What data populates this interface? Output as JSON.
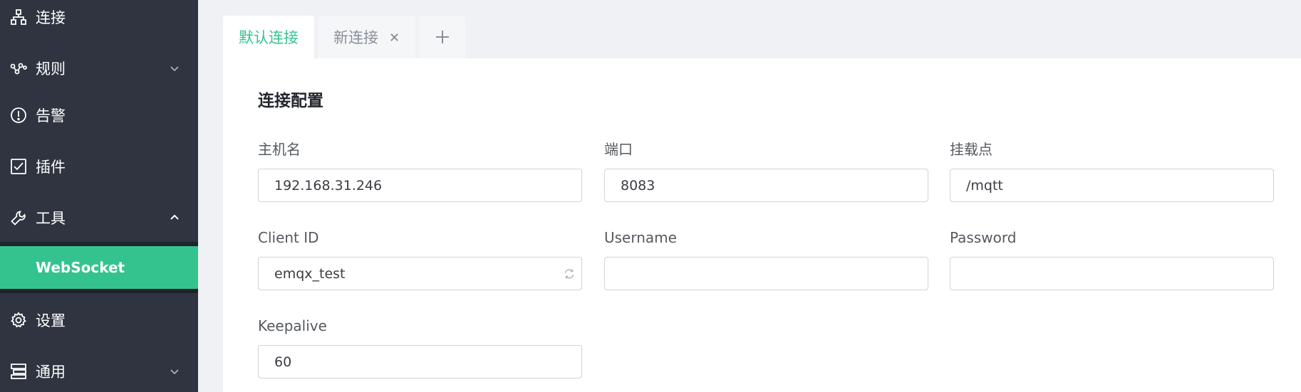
{
  "sidebar": {
    "items": [
      {
        "label": "连接",
        "icon": "network-icon"
      },
      {
        "label": "规则",
        "icon": "nodes-icon"
      },
      {
        "label": "告警",
        "icon": "alert-icon"
      },
      {
        "label": "插件",
        "icon": "checkbox-icon"
      },
      {
        "label": "工具",
        "icon": "wrench-icon"
      },
      {
        "label": "设置",
        "icon": "gear-icon"
      },
      {
        "label": "通用",
        "icon": "layers-icon"
      }
    ],
    "submenu": {
      "label": "WebSocket"
    }
  },
  "tabs": [
    {
      "label": "默认连接",
      "active": true
    },
    {
      "label": "新连接",
      "active": false
    }
  ],
  "panel": {
    "title": "连接配置",
    "fields": {
      "host": {
        "label": "主机名",
        "value": "192.168.31.246"
      },
      "port": {
        "label": "端口",
        "value": "8083"
      },
      "mount": {
        "label": "挂载点",
        "value": "/mqtt"
      },
      "client_id": {
        "label": "Client ID",
        "value": "emqx_test"
      },
      "username": {
        "label": "Username",
        "value": ""
      },
      "password": {
        "label": "Password",
        "value": ""
      },
      "keepalive": {
        "label": "Keepalive",
        "value": "60"
      }
    }
  },
  "colors": {
    "sidebar_bg": "#2f3440",
    "accent": "#34c38f",
    "panel_bg": "#ffffff",
    "page_bg": "#f0f1f4"
  }
}
